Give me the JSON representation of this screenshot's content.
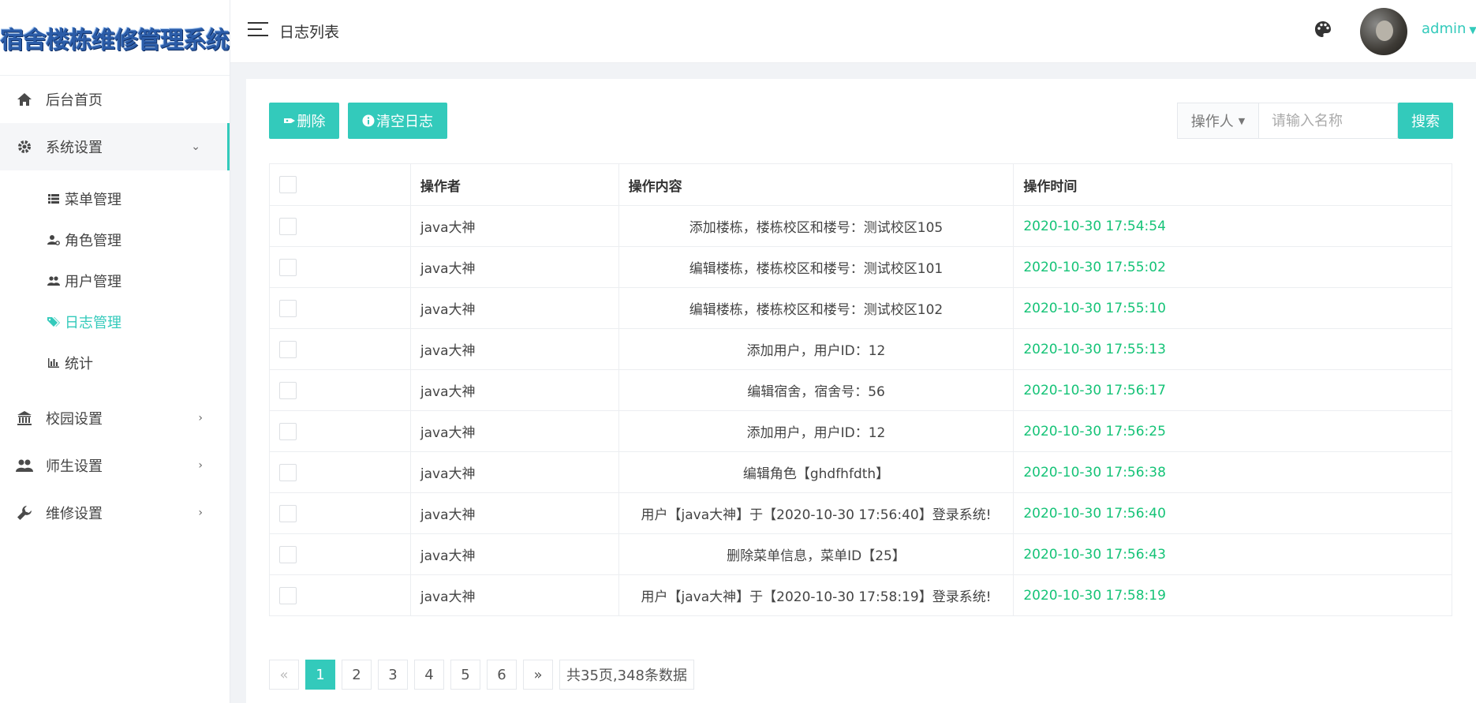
{
  "sidebar": {
    "brand": "宿舍楼栋维修管理系统",
    "items": [
      {
        "label": "后台首页",
        "icon": "home-icon"
      },
      {
        "label": "系统设置",
        "icon": "gear-icon",
        "open": true
      },
      {
        "label": "校园设置",
        "icon": "bank-icon"
      },
      {
        "label": "师生设置",
        "icon": "people-icon"
      },
      {
        "label": "维修设置",
        "icon": "wrench-icon"
      }
    ],
    "subitems": [
      {
        "label": "菜单管理",
        "icon": "list-icon"
      },
      {
        "label": "角色管理",
        "icon": "user-cog-icon"
      },
      {
        "label": "用户管理",
        "icon": "users-icon"
      },
      {
        "label": "日志管理",
        "icon": "tags-icon",
        "active": true
      },
      {
        "label": "统计",
        "icon": "bar-chart-icon"
      }
    ]
  },
  "header": {
    "title": "日志列表",
    "user": "admin"
  },
  "toolbar": {
    "delete_label": "删除",
    "clear_label": "清空日志",
    "filter_label": "操作人",
    "search_placeholder": "请输入名称",
    "search_label": "搜索"
  },
  "table": {
    "columns": [
      "操作者",
      "操作内容",
      "操作时间"
    ],
    "rows": [
      {
        "operator": "java大神",
        "content": "添加楼栋，楼栋校区和楼号：测试校区105",
        "time": "2020-10-30 17:54:54"
      },
      {
        "operator": "java大神",
        "content": "编辑楼栋，楼栋校区和楼号：测试校区101",
        "time": "2020-10-30 17:55:02"
      },
      {
        "operator": "java大神",
        "content": "编辑楼栋，楼栋校区和楼号：测试校区102",
        "time": "2020-10-30 17:55:10"
      },
      {
        "operator": "java大神",
        "content": "添加用户，用户ID：12",
        "time": "2020-10-30 17:55:13"
      },
      {
        "operator": "java大神",
        "content": "编辑宿舍，宿舍号：56",
        "time": "2020-10-30 17:56:17"
      },
      {
        "operator": "java大神",
        "content": "添加用户，用户ID：12",
        "time": "2020-10-30 17:56:25"
      },
      {
        "operator": "java大神",
        "content": "编辑角色【ghdfhfdth】",
        "time": "2020-10-30 17:56:38"
      },
      {
        "operator": "java大神",
        "content": "用户【java大神】于【2020-10-30 17:56:40】登录系统!",
        "time": "2020-10-30 17:56:40"
      },
      {
        "operator": "java大神",
        "content": "删除菜单信息，菜单ID【25】",
        "time": "2020-10-30 17:56:43"
      },
      {
        "operator": "java大神",
        "content": "用户【java大神】于【2020-10-30 17:58:19】登录系统!",
        "time": "2020-10-30 17:58:19"
      }
    ]
  },
  "pagination": {
    "prev": "«",
    "next": "»",
    "pages": [
      "1",
      "2",
      "3",
      "4",
      "5",
      "6"
    ],
    "current": "1",
    "summary": "共35页,348条数据"
  },
  "colors": {
    "accent": "#33cabb",
    "time_green": "#15c377"
  }
}
